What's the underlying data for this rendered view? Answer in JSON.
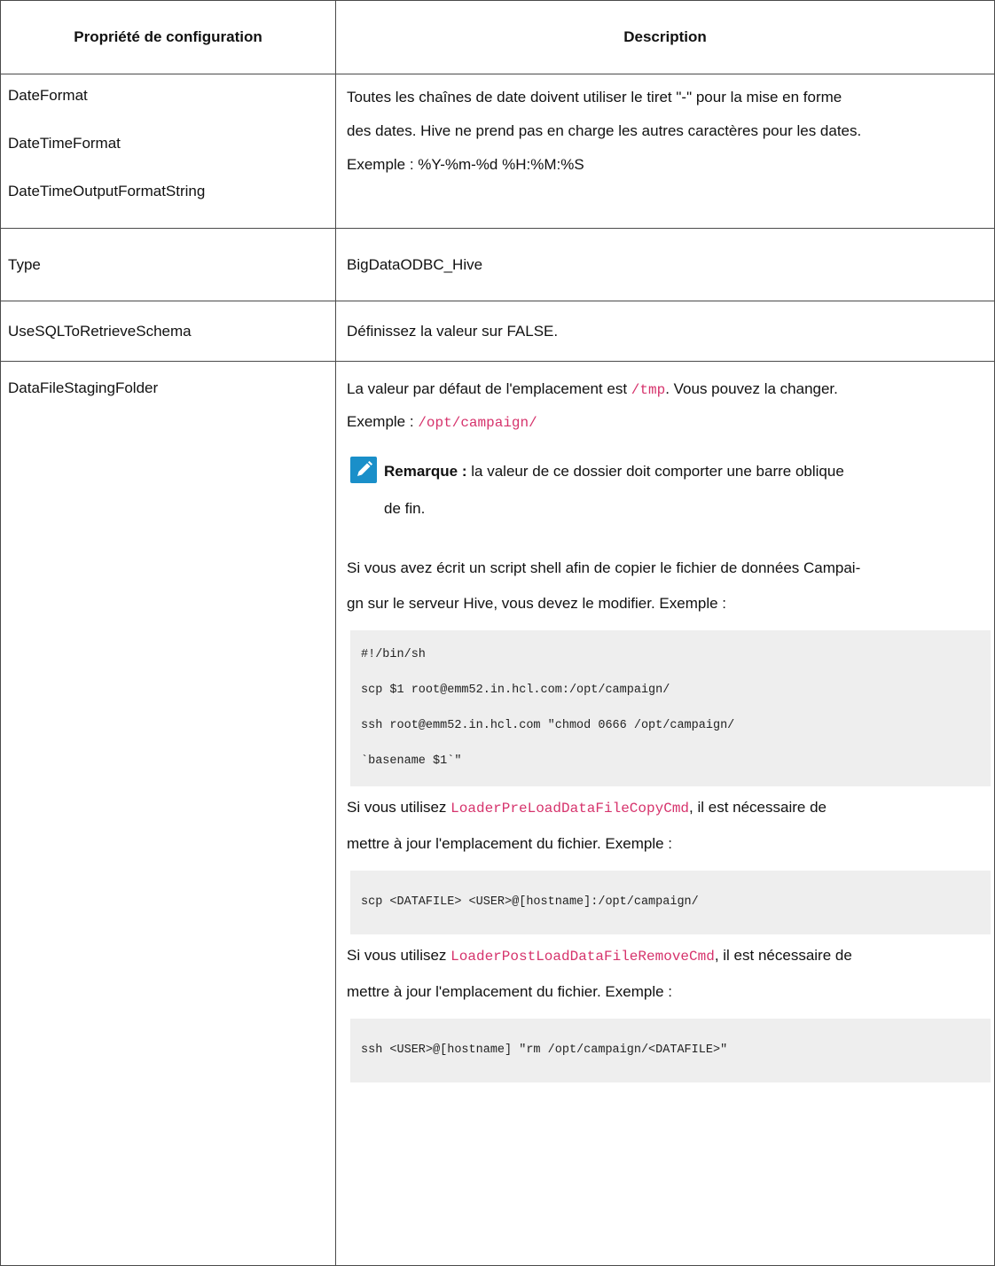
{
  "headers": {
    "property": "Propriété de configuration",
    "description": "Description"
  },
  "rows": [
    {
      "props": [
        "DateFormat",
        "DateTimeFormat",
        "DateTimeOutputFormatString"
      ],
      "desc_line1": "Toutes les chaînes de date doivent utiliser le tiret \"-\" pour la mise en forme",
      "desc_line2": "des dates. Hive ne prend pas en charge les autres caractères pour les dates.",
      "desc_line3": "Exemple : %Y-%m-%d %H:%M:%S"
    },
    {
      "prop": "Type",
      "desc": "BigDataODBC_Hive"
    },
    {
      "prop": "UseSQLToRetrieveSchema",
      "desc": "Définissez la valeur sur FALSE."
    },
    {
      "prop": "DataFileStagingFolder",
      "line1_prefix": "La valeur par défaut de l'emplacement est ",
      "line1_code": "/tmp",
      "line1_suffix": ". Vous pouvez la changer.",
      "line2_prefix": "Exemple : ",
      "line2_code": "/opt/campaign/",
      "note_label": "Remarque :",
      "note_line1": " la valeur de ce dossier doit comporter une barre oblique",
      "note_line2": "de fin.",
      "para1_line1": "Si vous avez écrit un script shell afin de copier le fichier de données Campai-",
      "para1_line2": "gn sur le serveur Hive, vous devez le modifier. Exemple :",
      "code1": [
        "#!/bin/sh",
        "scp $1 root@emm52.in.hcl.com:/opt/campaign/",
        "ssh root@emm52.in.hcl.com \"chmod 0666 /opt/campaign/",
        "`basename $1`\""
      ],
      "para2_prefix": "Si vous utilisez ",
      "para2_code": "LoaderPreLoadDataFileCopyCmd",
      "para2_suffix": ", il est nécessaire de",
      "para2_line2": "mettre à jour l'emplacement du fichier. Exemple :",
      "code2": "scp <DATAFILE> <USER>@[hostname]:/opt/campaign/",
      "para3_prefix": "Si vous utilisez ",
      "para3_code": "LoaderPostLoadDataFileRemoveCmd",
      "para3_suffix": ", il est nécessaire de",
      "para3_line2": "mettre à jour l'emplacement du fichier. Exemple :",
      "code3": "ssh <USER>@[hostname] \"rm /opt/campaign/<DATAFILE>\""
    }
  ],
  "icons": {
    "note": "pencil-icon"
  },
  "colors": {
    "note_icon_bg": "#1a8fc9",
    "code_text": "#d6336c",
    "code_bg": "#eeeeee"
  }
}
